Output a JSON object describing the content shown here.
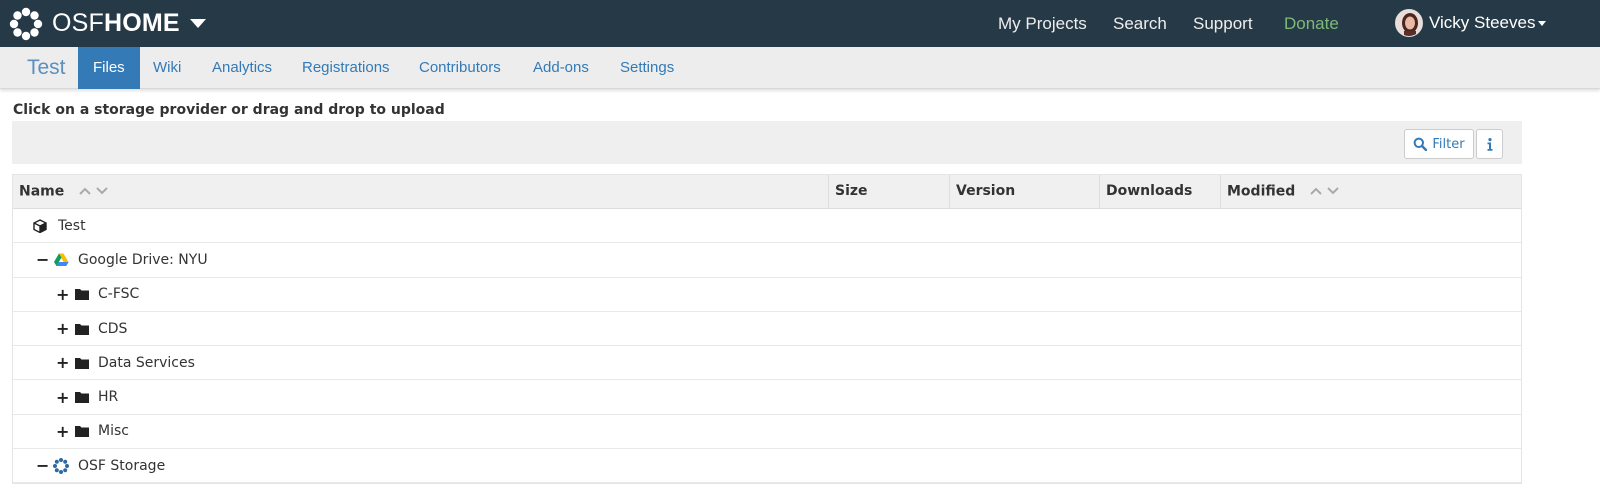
{
  "brand": {
    "prefix": "OSF",
    "suffix": "HOME"
  },
  "topnav": {
    "my_projects": "My Projects",
    "search": "Search",
    "support": "Support",
    "donate": "Donate",
    "user_name": "Vicky Steeves"
  },
  "project": {
    "title": "Test",
    "tabs": [
      "Files",
      "Wiki",
      "Analytics",
      "Registrations",
      "Contributors",
      "Add-ons",
      "Settings"
    ],
    "active_tab": "Files"
  },
  "files": {
    "instructions": "Click on a storage provider or drag and drop to upload",
    "filter_label": "Filter",
    "columns": [
      "Name",
      "Size",
      "Version",
      "Downloads",
      "Modified"
    ],
    "rows": [
      {
        "name": "Test",
        "icon": "project-cube-icon",
        "toggle": ""
      },
      {
        "name": "Google Drive: NYU",
        "icon": "google-drive-icon",
        "toggle": "−"
      },
      {
        "name": "C-FSC",
        "icon": "folder-icon",
        "toggle": "+"
      },
      {
        "name": "CDS",
        "icon": "folder-icon",
        "toggle": "+"
      },
      {
        "name": "Data Services",
        "icon": "folder-icon",
        "toggle": "+"
      },
      {
        "name": "HR",
        "icon": "folder-icon",
        "toggle": "+"
      },
      {
        "name": "Misc",
        "icon": "folder-icon",
        "toggle": "+"
      },
      {
        "name": "OSF Storage",
        "icon": "osf-storage-icon",
        "toggle": "−"
      }
    ]
  },
  "colors": {
    "navbar": "#263947",
    "accent": "#337ab7",
    "donate": "#7dba7a"
  }
}
